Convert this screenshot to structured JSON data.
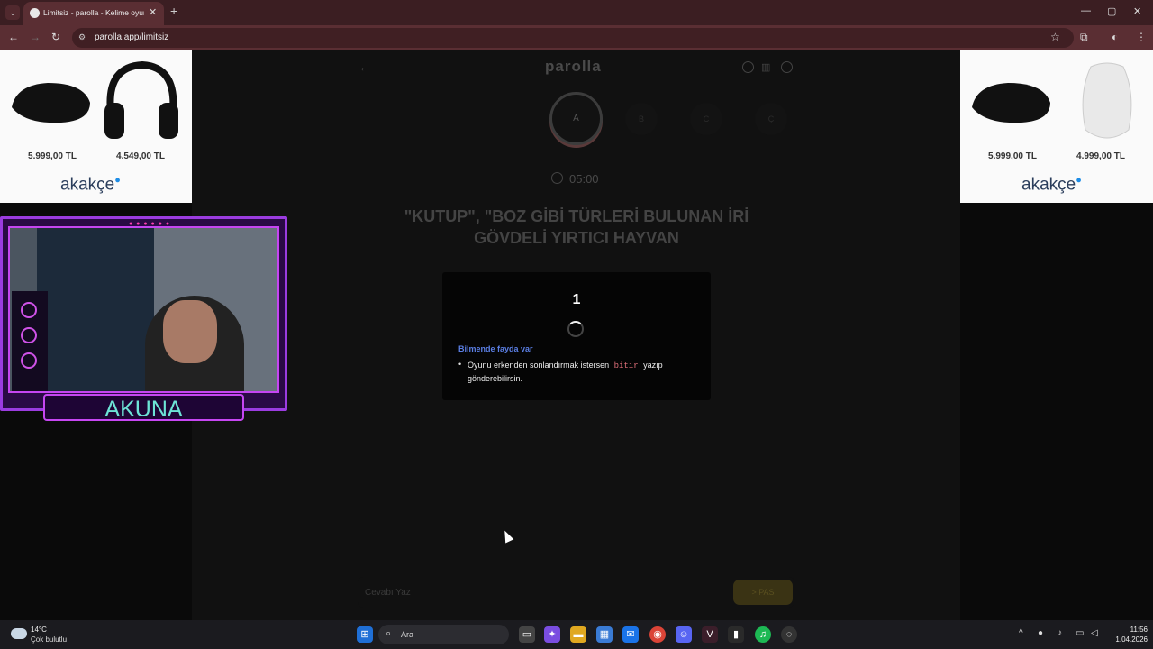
{
  "browser": {
    "tab_title": "Limitsiz - parolla - Kelime oyunu",
    "tab_close": "✕",
    "new_tab": "+",
    "url": "parolla.app/limitsiz",
    "window_controls": [
      "—",
      "▢",
      "✕"
    ]
  },
  "ads": {
    "left": {
      "price1": "5.999,00 TL",
      "price2": "4.549,00 TL",
      "brand": "akakçe"
    },
    "right": {
      "price1": "5.999,00 TL",
      "price2": "4.999,00 TL",
      "brand": "akakçe"
    }
  },
  "game": {
    "brand": "parolla",
    "letters": [
      "A",
      "B",
      "C",
      "Ç"
    ],
    "timer": "05:00",
    "question": "\"KUTUP\", \"BOZ GİBİ TÜRLERİ BULUNAN İRİ GÖVDELİ YIRTICI HAYVAN",
    "modal": {
      "countdown": "1",
      "tip_title": "Bilmende fayda var",
      "tip_before": "Oyunu erkenden sonlandırmak istersen",
      "tip_code": "bitir",
      "tip_after": "yazıp gönderebilirsin."
    },
    "answer_placeholder": "Cevabı Yaz",
    "pass_label": "> PAS"
  },
  "webcam": {
    "name": "AKUNA"
  },
  "taskbar": {
    "temperature": "14°C",
    "weather": "Çok bulutlu",
    "search_label": "Ara",
    "time": "11:56",
    "date": "1.04.2026"
  },
  "colors": {
    "accent_pink": "#e0707a",
    "tip_blue": "#5b7fe5",
    "frame_purple": "#9b3ce0",
    "name_cyan": "#6de4d6"
  }
}
